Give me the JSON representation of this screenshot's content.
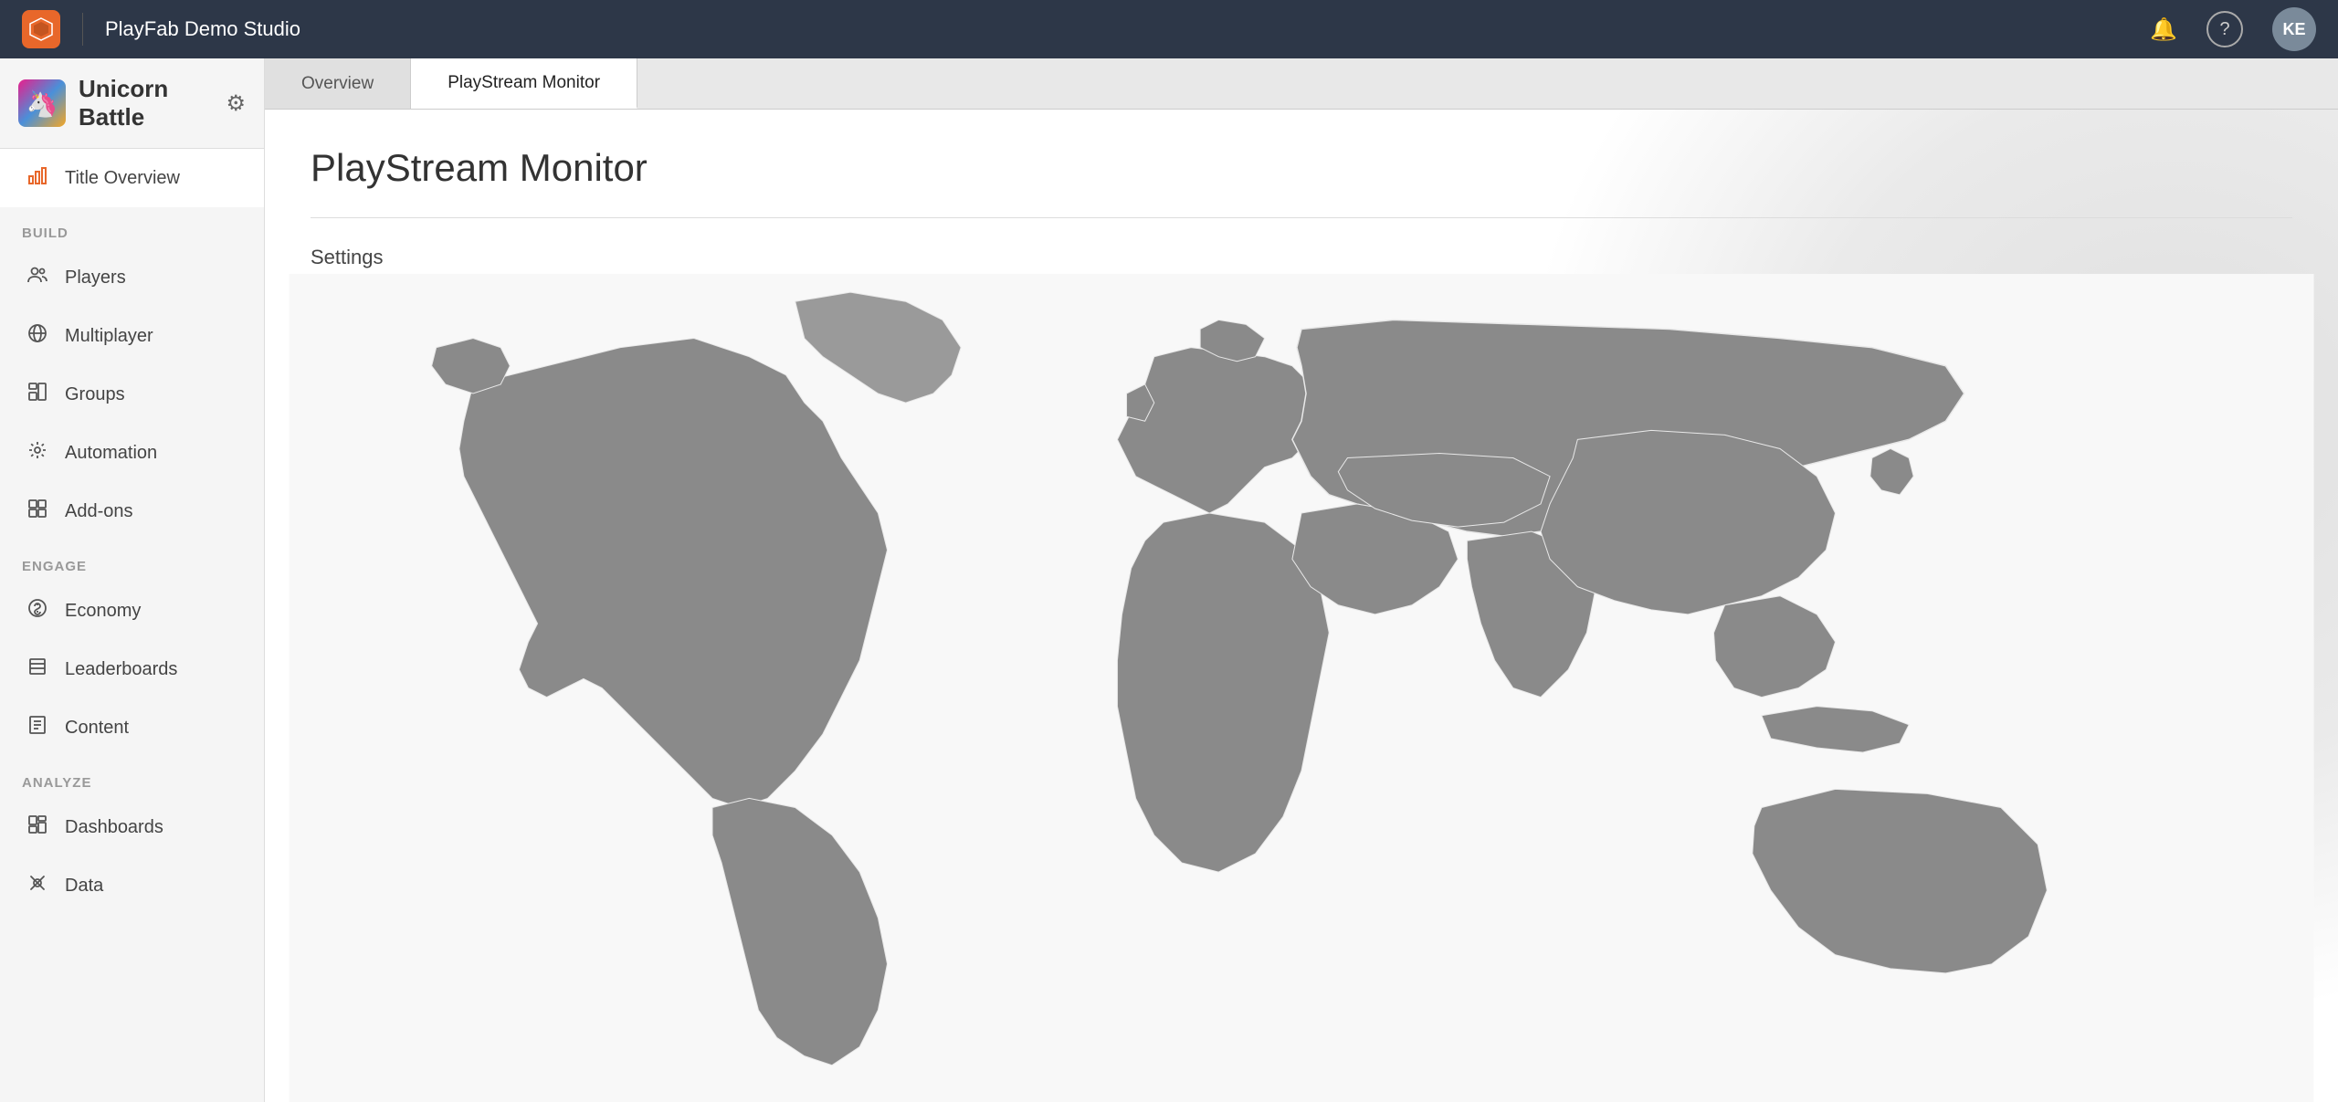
{
  "app": {
    "name": "PlayFab Demo Studio"
  },
  "nav": {
    "logo_text": "🔥",
    "title": "PlayFab Demo Studio",
    "notification_icon": "🔔",
    "help_icon": "?",
    "avatar_initials": "KE"
  },
  "sidebar": {
    "game_title": "Unicorn Battle",
    "settings_icon": "⚙",
    "active_item": "title-overview",
    "sections": [
      {
        "label": "",
        "items": [
          {
            "id": "title-overview",
            "label": "Title Overview",
            "icon": "📊"
          }
        ]
      },
      {
        "label": "BUILD",
        "items": [
          {
            "id": "players",
            "label": "Players",
            "icon": "👥"
          },
          {
            "id": "multiplayer",
            "label": "Multiplayer",
            "icon": "🌐"
          },
          {
            "id": "groups",
            "label": "Groups",
            "icon": "🗂"
          },
          {
            "id": "automation",
            "label": "Automation",
            "icon": "🤖"
          },
          {
            "id": "add-ons",
            "label": "Add-ons",
            "icon": "⊞"
          }
        ]
      },
      {
        "label": "ENGAGE",
        "items": [
          {
            "id": "economy",
            "label": "Economy",
            "icon": "🪙"
          },
          {
            "id": "leaderboards",
            "label": "Leaderboards",
            "icon": "🏷"
          },
          {
            "id": "content",
            "label": "Content",
            "icon": "📄"
          }
        ]
      },
      {
        "label": "ANALYZE",
        "items": [
          {
            "id": "dashboards",
            "label": "Dashboards",
            "icon": "📈"
          },
          {
            "id": "data",
            "label": "Data",
            "icon": "🔄"
          }
        ]
      }
    ]
  },
  "tabs": [
    {
      "id": "overview",
      "label": "Overview",
      "active": false
    },
    {
      "id": "playstream-monitor",
      "label": "PlayStream Monitor",
      "active": true
    }
  ],
  "main": {
    "page_title": "PlayStream Monitor",
    "settings_label": "Settings",
    "zoom_in_label": "+",
    "zoom_out_label": "−"
  }
}
